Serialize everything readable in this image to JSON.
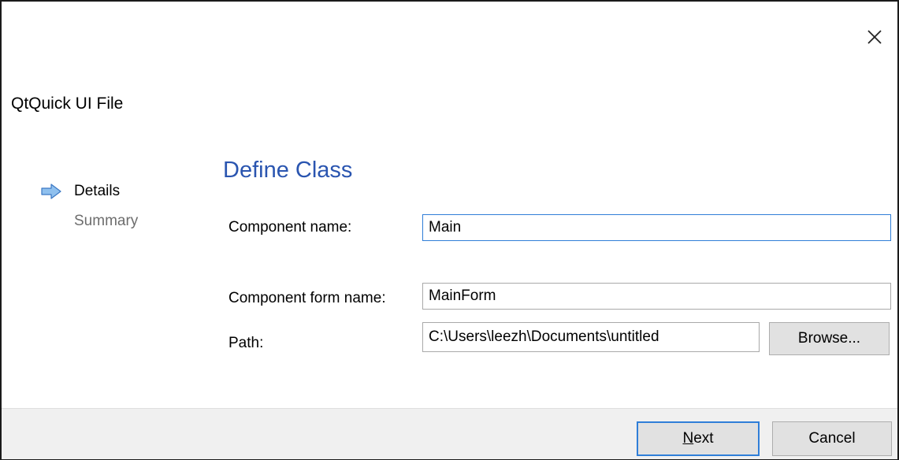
{
  "window": {
    "title": "QtQuick UI File",
    "close_icon": "close-icon"
  },
  "steps": {
    "current": {
      "label": "Details",
      "icon": "arrow-right-icon",
      "icon_color": "#4a8fd9"
    },
    "next": {
      "label": "Summary"
    }
  },
  "page": {
    "heading": "Define Class",
    "heading_color": "#2a55b0"
  },
  "form": {
    "component_name": {
      "label": "Component name:",
      "value": "Main"
    },
    "component_form_name": {
      "label": "Component form name:",
      "value": "MainForm"
    },
    "path": {
      "label": "Path:",
      "value": "C:\\Users\\leezh\\Documents\\untitled"
    },
    "browse_label": "Browse..."
  },
  "footer": {
    "next_mnemonic": "N",
    "next_rest": "ext",
    "cancel_label": "Cancel"
  },
  "colors": {
    "accent": "#2f7ed8",
    "footer_bg": "#f0f0f0",
    "button_bg": "#e1e1e1"
  }
}
